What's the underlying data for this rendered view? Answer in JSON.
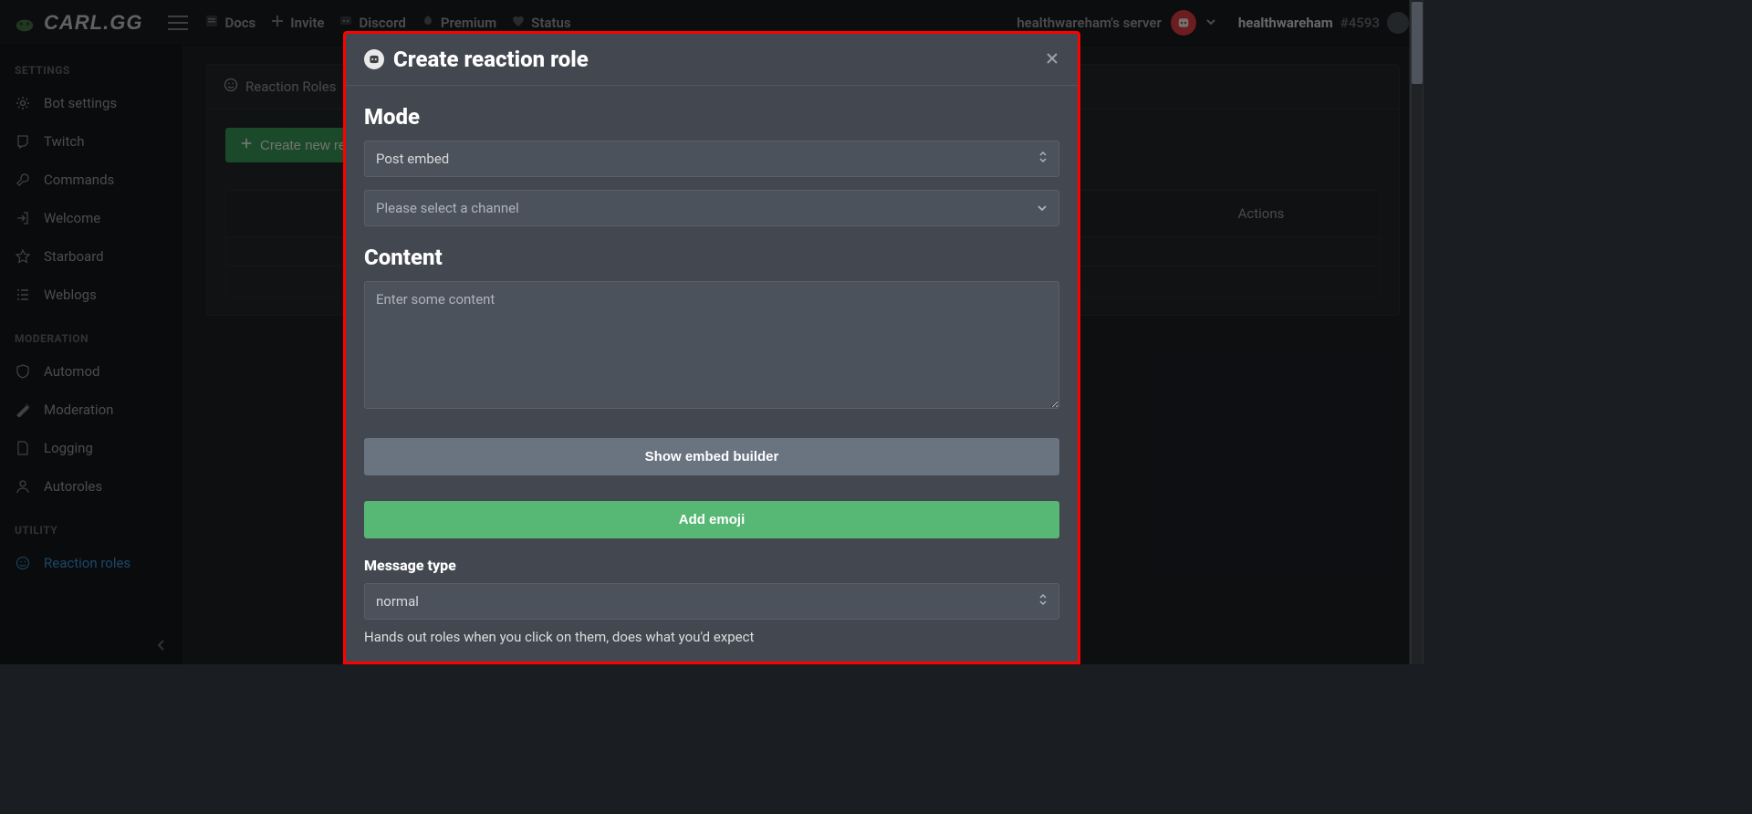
{
  "brand": "CARL.GG",
  "topnav": {
    "docs": "Docs",
    "invite": "Invite",
    "discord": "Discord",
    "premium": "Premium",
    "status": "Status"
  },
  "server": {
    "label": "healthwareham's server"
  },
  "user": {
    "name": "healthwareham",
    "tag": "#4593"
  },
  "sidebar": {
    "section_settings": "SETTINGS",
    "section_moderation": "MODERATION",
    "section_utility": "UTILITY",
    "items": {
      "bot_settings": "Bot settings",
      "twitch": "Twitch",
      "commands": "Commands",
      "welcome": "Welcome",
      "starboard": "Starboard",
      "weblogs": "Weblogs",
      "automod": "Automod",
      "moderation": "Moderation",
      "logging": "Logging",
      "autoroles": "Autoroles",
      "reaction_roles": "Reaction roles"
    }
  },
  "panel": {
    "tab_reaction_roles": "Reaction Roles",
    "create_button": "Create new reaction role",
    "table": {
      "col_actions": "Actions"
    }
  },
  "modal": {
    "title": "Create reaction role",
    "mode_heading": "Mode",
    "mode_value": "Post embed",
    "channel_placeholder": "Please select a channel",
    "content_heading": "Content",
    "content_placeholder": "Enter some content",
    "show_embed_builder": "Show embed builder",
    "add_emoji": "Add emoji",
    "message_type_heading": "Message type",
    "message_type_value": "normal",
    "message_type_help": "Hands out roles when you click on them, does what you'd expect"
  }
}
